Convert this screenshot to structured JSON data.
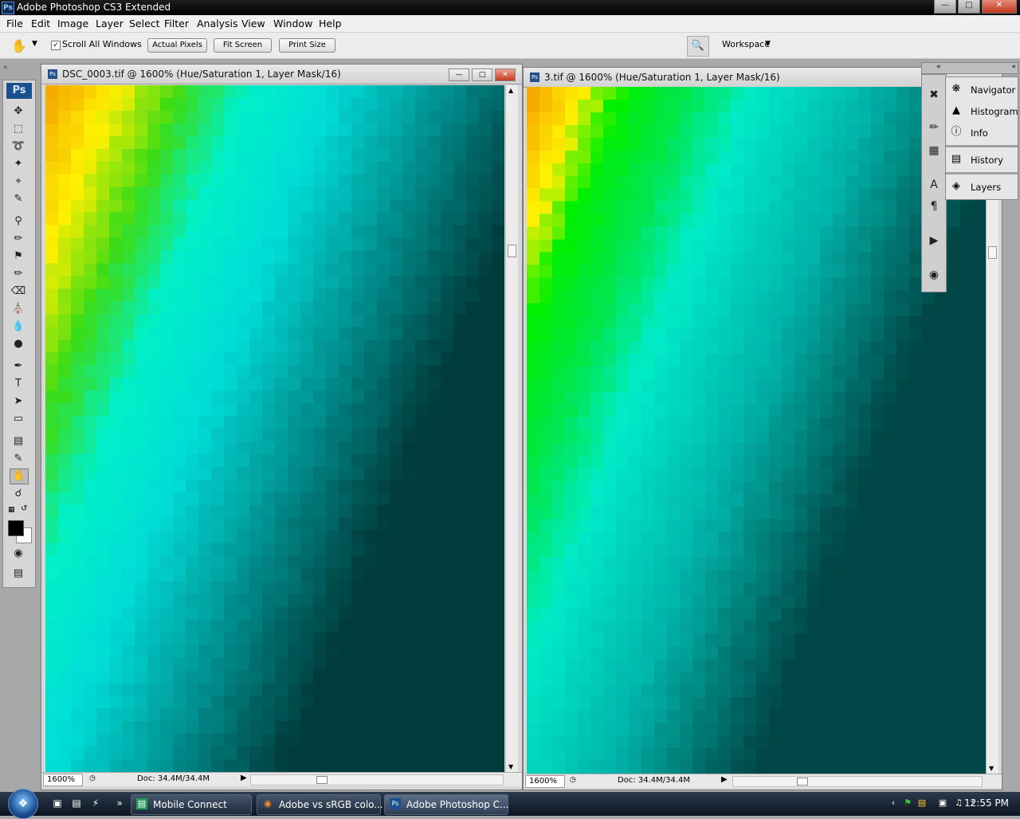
{
  "app": {
    "title": "Adobe Photoshop CS3 Extended",
    "logo": "Ps"
  },
  "menu": [
    "File",
    "Edit",
    "Image",
    "Layer",
    "Select",
    "Filter",
    "Analysis",
    "View",
    "Window",
    "Help"
  ],
  "options": {
    "scroll_all_label": "Scroll All Windows",
    "scroll_all_checked": true,
    "actual_pixels": "Actual Pixels",
    "fit_screen": "Fit Screen",
    "print_size": "Print Size",
    "workspace": "Workspace"
  },
  "toolbox": {
    "logo": "Ps"
  },
  "doc1": {
    "title": "DSC_0003.tif @ 1600% (Hue/Saturation 1, Layer Mask/16)",
    "zoom": "1600%",
    "doc_size": "Doc: 34.4M/34.4M"
  },
  "doc2": {
    "title": "3.tif @ 1600% (Hue/Saturation 1, Layer Mask/16)",
    "zoom": "1600%",
    "doc_size": "Doc: 34.4M/34.4M"
  },
  "panels": [
    "Navigator",
    "Histogram",
    "Info",
    "History",
    "Layers"
  ],
  "taskbar": {
    "items": [
      "Mobile Connect",
      "Adobe vs sRGB colo...",
      "Adobe Photoshop C..."
    ],
    "clock": "12:55 PM"
  },
  "colors": {
    "foreground": "#000000",
    "background": "#ffffff"
  }
}
